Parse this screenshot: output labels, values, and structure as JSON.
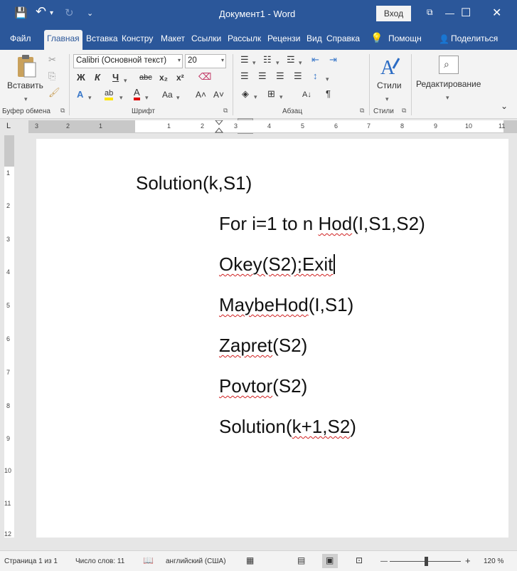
{
  "window": {
    "title": "Документ1  -  Word",
    "login": "Вход",
    "minimize_glyph": "—",
    "maximize_glyph": "☐",
    "close_glyph": "✕",
    "restore_glyph": "⧉"
  },
  "quick_access": {
    "save_glyph": "💾",
    "undo_glyph": "↶",
    "undo_dd": "▾",
    "redo_glyph": "↻",
    "customize_glyph": "⌄"
  },
  "tabs": [
    {
      "label": "Файл",
      "active": false
    },
    {
      "label": "Главная",
      "active": true
    },
    {
      "label": "Вставка",
      "active": false
    },
    {
      "label": "Констру",
      "active": false
    },
    {
      "label": "Макет",
      "active": false
    },
    {
      "label": "Ссылки",
      "active": false
    },
    {
      "label": "Рассылк",
      "active": false
    },
    {
      "label": "Рецензи",
      "active": false
    },
    {
      "label": "Вид",
      "active": false
    },
    {
      "label": "Справка",
      "active": false
    }
  ],
  "tab_extras": {
    "help_search": "Помощн",
    "share": "Поделиться",
    "lightbulb_glyph": "💡",
    "person_glyph": "👤"
  },
  "ribbon": {
    "clipboard": {
      "paste_label": "Вставить",
      "group_label": "Буфер обмена",
      "cut_glyph": "✂",
      "copy_glyph": "⎘",
      "painter_glyph": "🖌"
    },
    "font": {
      "font_name": "Calibri (Основной текст)",
      "font_size": "20",
      "bold": "Ж",
      "italic": "К",
      "underline": "Ч",
      "strike": "abc",
      "subscript": "x₂",
      "superscript": "x²",
      "effects_glyph": "A",
      "highlight_glyph": "ab",
      "font_color_glyph": "A",
      "case_glyph": "Aa",
      "grow_glyph": "A˄",
      "shrink_glyph": "A˅",
      "clear_glyph": "A",
      "group_label": "Шрифт"
    },
    "paragraph": {
      "group_label": "Абзац",
      "sort_glyph": "A↓",
      "pilcrow_glyph": "¶"
    },
    "styles": {
      "label": "Стили",
      "group_label": "Стили"
    },
    "editing": {
      "label": "Редактирование"
    }
  },
  "rulers": {
    "horizontal_numbers": [
      "3",
      "2",
      "1",
      "1",
      "2",
      "3",
      "4",
      "5",
      "6",
      "7",
      "8",
      "9",
      "10",
      "11"
    ],
    "vertical_numbers": [
      "1",
      "2",
      "3",
      "4",
      "5",
      "6",
      "7",
      "8",
      "9",
      "10",
      "11",
      "12"
    ]
  },
  "document": {
    "lines": [
      {
        "text": "Solution(k,S1)",
        "squiggle": ""
      },
      {
        "text": "For i=1 to n Hod(I,S1,S2)",
        "squiggle": "Hod"
      },
      {
        "text": "Okey(S2);Exit",
        "squiggle": "Okey(S2);Exit"
      },
      {
        "text": "MaybeHod(I,S1)",
        "squiggle": "MaybeHod"
      },
      {
        "text": "Zapret(S2)",
        "squiggle": "Zapret"
      },
      {
        "text": "Povtor(S2)",
        "squiggle": "Povtor"
      },
      {
        "text": "Solution(k+1,S2)",
        "squiggle": "k+1,S2"
      }
    ]
  },
  "statusbar": {
    "page": "Страница 1 из 1",
    "words": "Число слов: 11",
    "language": "английский (США)",
    "zoom": "120 %",
    "zoom_minus": "—",
    "zoom_plus": "+"
  }
}
